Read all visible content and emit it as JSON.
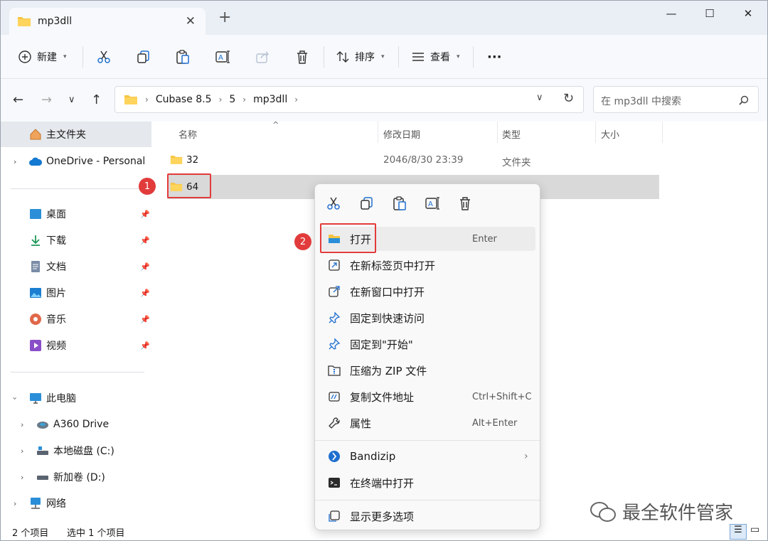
{
  "window": {
    "tab_title": "mp3dll",
    "tab_close": "✕",
    "new_tab": "+",
    "minimize": "—",
    "maximize": "☐",
    "close": "✕"
  },
  "toolbar": {
    "new_label": "新建",
    "sort_label": "排序",
    "view_label": "查看",
    "more_label": "···"
  },
  "breadcrumb": [
    "Cubase 8.5",
    "5",
    "mp3dll"
  ],
  "search": {
    "placeholder": "在 mp3dll 中搜索"
  },
  "sidebar": {
    "home": "主文件夹",
    "onedrive": "OneDrive - Personal",
    "quick": [
      "桌面",
      "下载",
      "文档",
      "图片",
      "音乐",
      "视频"
    ],
    "thispc": "此电脑",
    "drives": [
      "A360 Drive",
      "本地磁盘 (C:)",
      "新加卷 (D:)"
    ],
    "network": "网络"
  },
  "columns": {
    "name": "名称",
    "date": "修改日期",
    "type": "类型",
    "size": "大小"
  },
  "files": [
    {
      "name": "32",
      "date": "2046/8/30 23:39",
      "type": "文件夹"
    },
    {
      "name": "64"
    }
  ],
  "context_menu": {
    "items": [
      {
        "label": "打开",
        "shortcut": "Enter"
      },
      {
        "label": "在新标签页中打开"
      },
      {
        "label": "在新窗口中打开"
      },
      {
        "label": "固定到快速访问"
      },
      {
        "label": "固定到\"开始\""
      },
      {
        "label": "压缩为 ZIP 文件"
      },
      {
        "label": "复制文件地址",
        "shortcut": "Ctrl+Shift+C"
      },
      {
        "label": "属性",
        "shortcut": "Alt+Enter"
      },
      {
        "label": "Bandizip"
      },
      {
        "label": "在终端中打开"
      },
      {
        "label": "显示更多选项"
      }
    ]
  },
  "annotations": {
    "step1": "1",
    "step2": "2"
  },
  "status": {
    "count": "2 个项目",
    "selected": "选中 1 个项目"
  },
  "watermark": "最全软件管家",
  "colors": {
    "accent": "#e23b3b",
    "folder": "#f5c542",
    "selection": "#d9d9d9"
  }
}
